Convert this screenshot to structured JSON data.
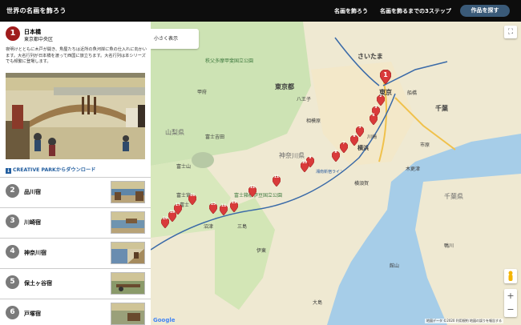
{
  "header": {
    "site_title": "世界の名画を飾ろう",
    "nav": [
      "名画を飾ろう",
      "名画を飾るまでの3ステップ"
    ],
    "cta_label": "作品を探す"
  },
  "sidebar": {
    "active": {
      "number": "1",
      "title": "日本橋",
      "location": "東京都中央区",
      "description": "夜明けとともに木戸が開き、魚屋たちは近所の魚河岸に魚の仕入れに向かいます。大名行列が日本橋を渡って西国に旅立ちます。大名行列は本シリーズでも頻繁に登場します。"
    },
    "download_label": "CREATIVE PARKからダウンロード",
    "stations": [
      {
        "number": "2",
        "label": "品川宿"
      },
      {
        "number": "3",
        "label": "川崎宿"
      },
      {
        "number": "4",
        "label": "神奈川宿"
      },
      {
        "number": "5",
        "label": "保土ヶ谷宿"
      },
      {
        "number": "6",
        "label": "戸塚宿"
      }
    ]
  },
  "map": {
    "small_view_label": "小さく表示",
    "place_labels": {
      "saitama": "さいたま",
      "tokyo_metro": "東京都",
      "tokyo": "東京",
      "chiba": "千葉",
      "chiba_pref": "千葉県",
      "yamanashi": "山梨県",
      "kanagawa": "神奈川県",
      "kawasaki": "川崎",
      "yokohama": "横浜",
      "yokosuka": "横須賀",
      "fujisan": "富士山",
      "fuji_hakone": "富士箱根伊豆国立公園",
      "chichibu": "秩父多摩甲斐国立公園",
      "kofu": "甲府",
      "hachioji": "八王子",
      "sagamihara": "相模原",
      "fujiyoshida": "富士吉田",
      "fujinomiya": "富士宮",
      "numazu": "沼津",
      "mishima": "三島",
      "ito": "伊東",
      "oshima": "大島",
      "fuji": "富士",
      "funabashi": "船橋",
      "ichihara": "市原",
      "kisarazu": "木更津",
      "tateyama": "館山",
      "kamogawa": "鴨川",
      "shonan": "湘南新宿ライン"
    },
    "markers": [
      "1",
      "2",
      "3",
      "4",
      "5",
      "6",
      "7",
      "8",
      "9",
      "10",
      "11",
      "12",
      "13",
      "14",
      "15",
      "16",
      "17",
      "18",
      "19"
    ],
    "google_logo": "Google",
    "attribution": "地図データ ©2020   利用規約   地図の誤りを報告する"
  }
}
